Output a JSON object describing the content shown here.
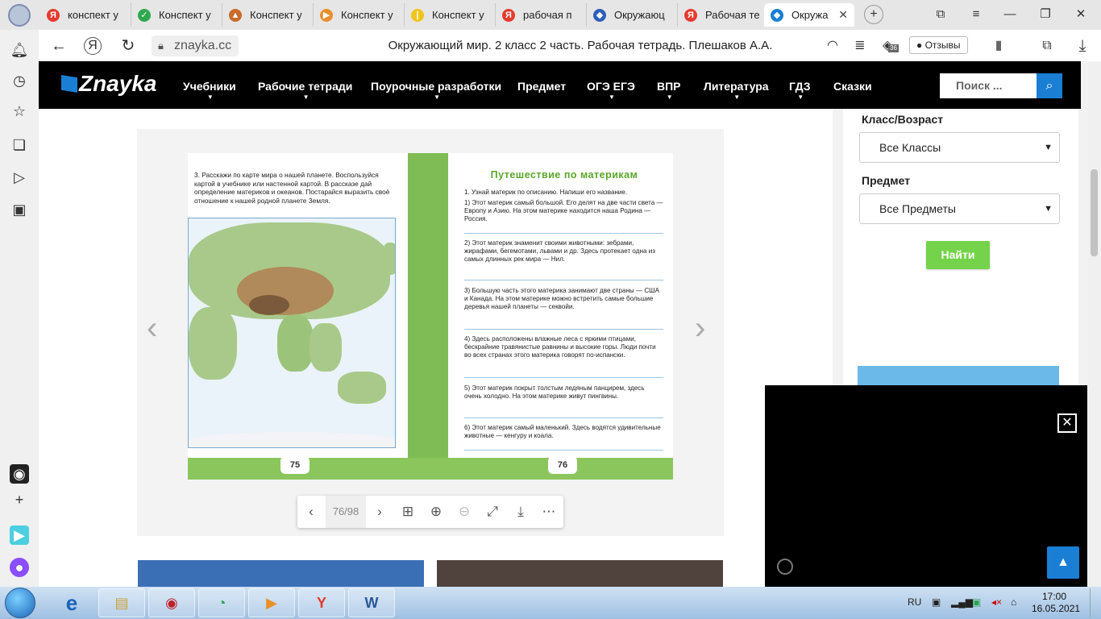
{
  "browser": {
    "tabs": [
      {
        "label": "конспект у",
        "icon": "yandex-icon",
        "color": "#e63b2e",
        "glyph": "Я"
      },
      {
        "label": "Конспект у",
        "icon": "check-icon",
        "color": "#2fa84f",
        "glyph": "✓"
      },
      {
        "label": "Конспект у",
        "icon": "hat-icon",
        "color": "#c96b2b",
        "glyph": "▲"
      },
      {
        "label": "Конспект у",
        "icon": "paperplane-icon",
        "color": "#e8902a",
        "glyph": "▶"
      },
      {
        "label": "Конспект у",
        "icon": "pencil-icon",
        "color": "#f0c419",
        "glyph": "|"
      },
      {
        "label": "рабочая п",
        "icon": "yandex-icon",
        "color": "#e63b2e",
        "glyph": "Я"
      },
      {
        "label": "Окружаюц",
        "icon": "shield-icon",
        "color": "#2d5fb8",
        "glyph": "◆"
      },
      {
        "label": "Рабочая те",
        "icon": "yandex-icon",
        "color": "#e63b2e",
        "glyph": "Я"
      },
      {
        "label": "Окружа",
        "icon": "znayka-icon",
        "color": "#1a7fd4",
        "glyph": "◆"
      }
    ],
    "url": "znayka.cc",
    "page_title": "Окружающий мир. 2 класс 2 часть. Рабочая тетрадь. Плешаков А.А.",
    "reviews_label": "Отзывы",
    "badge": "36"
  },
  "site": {
    "logo": "Znayka",
    "nav": [
      "Учебники",
      "Рабочие тетради",
      "Поурочные разработки",
      "Предмет",
      "ОГЭ ЕГЭ",
      "ВПР",
      "Литература",
      "ГДЗ",
      "Сказки"
    ],
    "search_placeholder": "Поиск ..."
  },
  "book": {
    "left_page_number": "75",
    "right_page_number": "76",
    "task3": "3. Расскажи по карте мира о нашей планете. Воспользуйся картой в учебнике или настенной картой. В рассказе дай определение материков и океанов. Постарайся выразить своё отношение к нашей родной планете Земля.",
    "title": "Путешествие по материкам",
    "task1_intro": "1. Узнай материк по описанию. Напиши его название.",
    "questions": [
      "1) Этот материк самый большой. Его делят на две части света — Европу и Азию. На этом материке находится наша Родина — Россия.",
      "2) Этот материк знаменит своими животными: зебрами, жирафами, бегемотами, львами и др. Здесь протекает одна из самых длинных рек мира — Нил.",
      "3) Большую часть этого материка занимают две страны — США и Канада. На этом материке можно встретить самые большие деревья нашей планеты — секвойи.",
      "4) Здесь расположены влажные леса с яркими птицами, бескрайние травянистые равнины и высокие горы. Люди почти во всех странах этого материка говорят по-испански.",
      "5) Этот материк покрыт толстым ледяным панцирем, здесь очень холодно. На этом материке живут пингвины.",
      "6) Этот материк самый маленький. Здесь водятся удивительные животные — кенгуру и коала."
    ]
  },
  "viewer": {
    "page_counter": "76/98"
  },
  "filters": {
    "class_label": "Класс/Возраст",
    "class_value": "Все Классы",
    "subject_label": "Предмет",
    "subject_value": "Все Предметы",
    "find_button": "Найти"
  },
  "taskbar": {
    "language": "RU",
    "time": "17:00",
    "date": "16.05.2021"
  }
}
